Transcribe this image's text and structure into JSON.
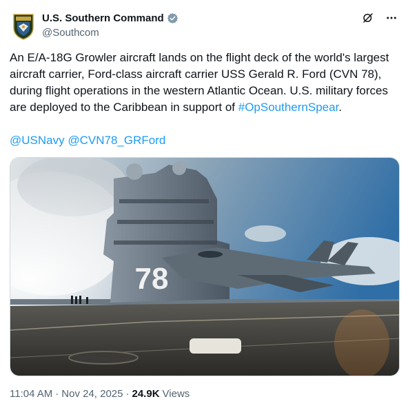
{
  "account": {
    "display_name": "U.S. Southern Command",
    "handle": "@Southcom"
  },
  "tweet": {
    "text_part1": "An E/A-18G Growler aircraft lands on the flight deck of the world's largest aircraft carrier, Ford-class aircraft carrier USS Gerald R. Ford (CVN 78), during flight operations in the western Atlantic Ocean. U.S. military forces are deployed to the Caribbean in support of ",
    "hashtag": "#OpSouthernSpear",
    "text_part2": ".",
    "mention1": "@USNavy",
    "mention2": "@CVN78_GRFord"
  },
  "media": {
    "hull_number": "78"
  },
  "meta": {
    "time": "11:04 AM",
    "separator1": "·",
    "date": "Nov 24, 2025",
    "separator2": "·",
    "views_count": "24.9K",
    "views_label": "Views"
  },
  "icons": {
    "verified": "verified-badge-icon",
    "grok": "grok-icon",
    "more": "more-icon"
  },
  "colors": {
    "link": "#1d9bf0",
    "verified_badge": "#829aab",
    "secondary_text": "#536471"
  }
}
